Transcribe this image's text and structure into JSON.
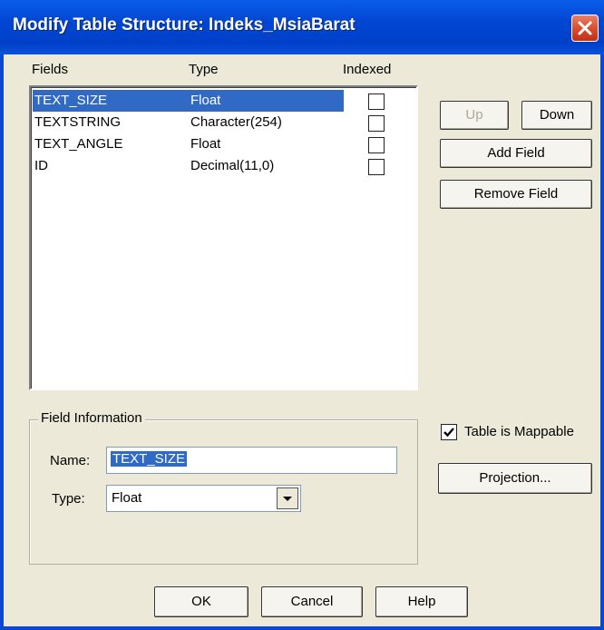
{
  "window": {
    "title": "Modify Table Structure: Indeks_MsiaBarat"
  },
  "fields_list": {
    "headers": {
      "fields": "Fields",
      "type": "Type",
      "indexed": "Indexed"
    },
    "rows": [
      {
        "name": "TEXT_SIZE",
        "type": "Float",
        "indexed": false,
        "selected": true
      },
      {
        "name": "TEXTSTRING",
        "type": "Character(254)",
        "indexed": false,
        "selected": false
      },
      {
        "name": "TEXT_ANGLE",
        "type": "Float",
        "indexed": false,
        "selected": false
      },
      {
        "name": "ID",
        "type": "Decimal(11,0)",
        "indexed": false,
        "selected": false
      }
    ]
  },
  "side_buttons": {
    "up": "Up",
    "down": "Down",
    "add_field": "Add Field",
    "remove_field": "Remove Field"
  },
  "field_info": {
    "group_label": "Field Information",
    "name_label": "Name:",
    "name_value": "TEXT_SIZE",
    "type_label": "Type:",
    "type_value": "Float"
  },
  "mappable": {
    "label": "Table is Mappable",
    "checked": true
  },
  "projection_button": "Projection...",
  "footer": {
    "ok": "OK",
    "cancel": "Cancel",
    "help": "Help"
  },
  "colors": {
    "titlebar": "#0046D5",
    "selection": "#316AC5",
    "dialog_bg": "#ECE9D8"
  },
  "icons": {
    "close": "close-icon",
    "dropdown": "chevron-down-icon",
    "check": "check-icon"
  }
}
